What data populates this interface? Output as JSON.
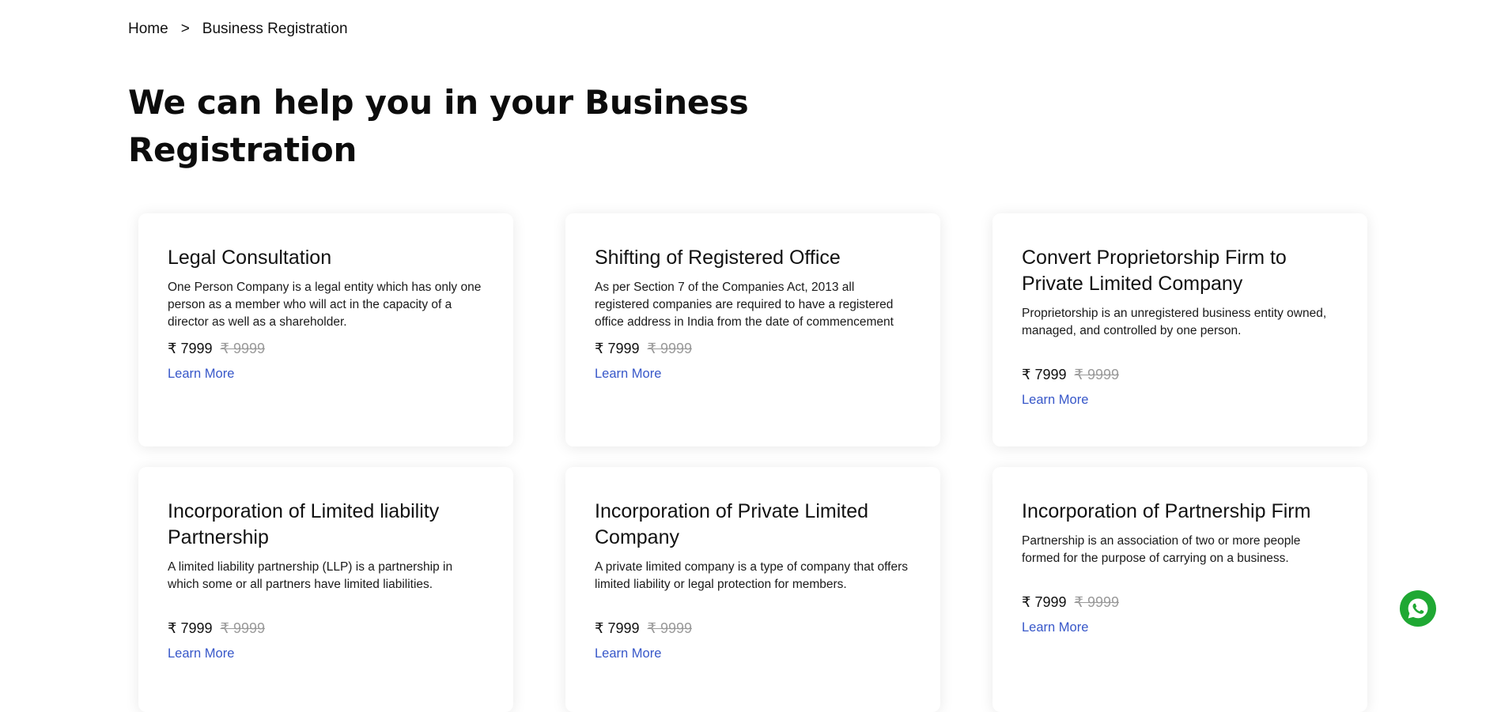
{
  "breadcrumb": {
    "home": "Home",
    "separator": ">",
    "current": "Business Registration"
  },
  "page": {
    "title": "We can help you in your Business Registration"
  },
  "cards": [
    {
      "title": "Legal Consultation",
      "description": "One Person Company is a legal entity which has only one person as a member who will act in the capacity of a director as well as a shareholder.",
      "price": "₹ 7999",
      "old_price": "₹ 9999",
      "link": "Learn More"
    },
    {
      "title": "Shifting of Registered Office",
      "description": "As per Section 7 of the Companies Act, 2013 all registered companies are required to have a registered office address in India from the date of commencement",
      "price": "₹ 7999",
      "old_price": "₹ 9999",
      "link": "Learn More"
    },
    {
      "title": "Convert Proprietorship Firm to Private Limited Company",
      "description": "Proprietorship is an unregistered business entity owned, managed, and controlled by one person.",
      "price": "₹ 7999",
      "old_price": "₹ 9999",
      "link": "Learn More"
    },
    {
      "title": "Incorporation of Limited liability Partnership",
      "description": "A limited liability partnership (LLP) is a partnership in which some or all partners have limited liabilities.",
      "price": "₹ 7999",
      "old_price": "₹ 9999",
      "link": "Learn More"
    },
    {
      "title": "Incorporation of Private Limited Company",
      "description": "A private limited company is a type of company that offers limited liability or legal protection for members.",
      "price": "₹ 7999",
      "old_price": "₹ 9999",
      "link": "Learn More"
    },
    {
      "title": "Incorporation of Partnership Firm",
      "description": "Partnership is an association of two or more people formed for the purpose of carrying on a business.",
      "price": "₹ 7999",
      "old_price": "₹ 9999",
      "link": "Learn More"
    }
  ],
  "icons": {
    "whatsapp": "whatsapp-icon"
  },
  "colors": {
    "link": "#3757c9",
    "whatsapp": "#1fa833",
    "old_price": "#9a9a9a"
  }
}
